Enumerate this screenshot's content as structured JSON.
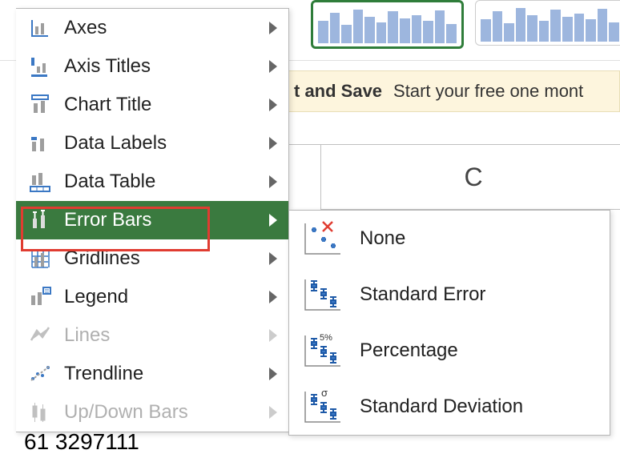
{
  "banner": {
    "bold_text": "t and Save",
    "rest_text": "Start your free one mont"
  },
  "columns": {
    "c": "C"
  },
  "peek_value": "61 3297111",
  "menu": {
    "axes": "Axes",
    "axis_titles": "Axis Titles",
    "chart_title": "Chart Title",
    "data_labels": "Data Labels",
    "data_table": "Data Table",
    "error_bars": "Error Bars",
    "gridlines": "Gridlines",
    "legend": "Legend",
    "lines": "Lines",
    "trendline": "Trendline",
    "updown": "Up/Down Bars"
  },
  "submenu": {
    "none": "None",
    "std_error": "Standard Error",
    "percentage": "Percentage",
    "std_dev": "Standard Deviation"
  }
}
